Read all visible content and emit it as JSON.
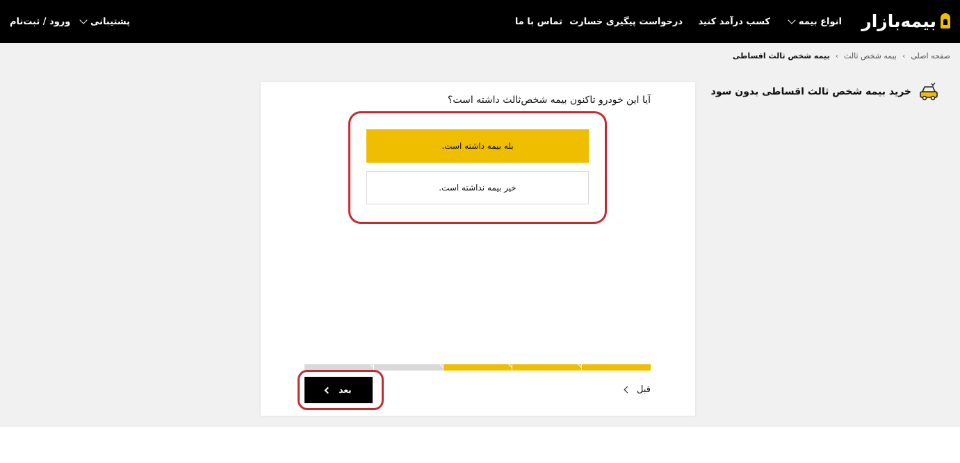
{
  "header": {
    "logo_text": "بیمه‌بازار",
    "nav": {
      "insurance_types": "انواع بیمه",
      "earn_money": "کسب درآمد کنید",
      "claim_request": "درخواست پیگیری خسارت",
      "contact_us": "تماس با ما",
      "support": "پشتیبانی",
      "login": "ورود / ثبت‌نام"
    }
  },
  "breadcrumb": {
    "home": "صفحه اصلی",
    "third_party": "بیمه شخص ثالث",
    "current": "بیمه شخص ثالث اقساطی"
  },
  "page": {
    "title": "خرید بیمه شخص ثالث اقساطی بدون سود"
  },
  "wizard": {
    "question": "آیا این خودرو تاکنون بیمه شخص‌ثالث داشته است؟",
    "options": [
      {
        "label": "بله بیمه داشته است.",
        "selected": true
      },
      {
        "label": "خیر بیمه نداشته است.",
        "selected": false
      }
    ],
    "progress": {
      "total_steps": 5,
      "completed_steps": 3
    },
    "next_label": "بعد",
    "prev_label": "قبل"
  },
  "colors": {
    "accent": "#f0be00",
    "highlight": "#c62a31",
    "header_bg": "#000000",
    "progress_inactive": "#d9d9d9"
  },
  "icons": {
    "logo": "logo-mark-icon",
    "car": "car-icon",
    "dropdown": "chevron-down-icon",
    "next": "chevron-left-icon",
    "prev": "chevron-left-icon"
  }
}
